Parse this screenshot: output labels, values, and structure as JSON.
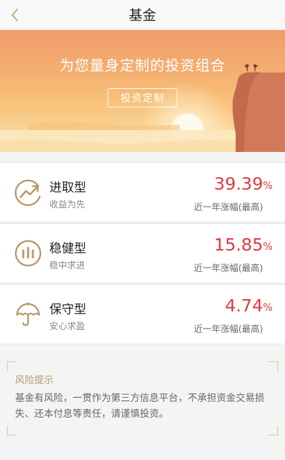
{
  "nav": {
    "title": "基金",
    "back_icon": "chevron-left-icon"
  },
  "banner": {
    "title": "为您量身定制的投资组合",
    "button_label": "投资定制"
  },
  "funds": [
    {
      "icon": "trend-up-icon",
      "name": "进取型",
      "subtitle": "收益为先",
      "rate": "39.39",
      "rate_unit": "%",
      "rate_label": "近一年涨幅(最高)"
    },
    {
      "icon": "bars-circle-icon",
      "name": "稳健型",
      "subtitle": "稳中求进",
      "rate": "15.85",
      "rate_unit": "%",
      "rate_label": "近一年涨幅(最高)"
    },
    {
      "icon": "umbrella-icon",
      "name": "保守型",
      "subtitle": "安心求盈",
      "rate": "4.74",
      "rate_unit": "%",
      "rate_label": "近一年涨幅(最高)"
    }
  ],
  "risk": {
    "title": "风险提示",
    "body": "基金有风险，一贯作为第三方信息平台，不承担资金交易损失、还本付息等责任，请谨慎投资。"
  },
  "colors": {
    "accent_gold": "#b5996b",
    "rate_red": "#e0393f"
  }
}
